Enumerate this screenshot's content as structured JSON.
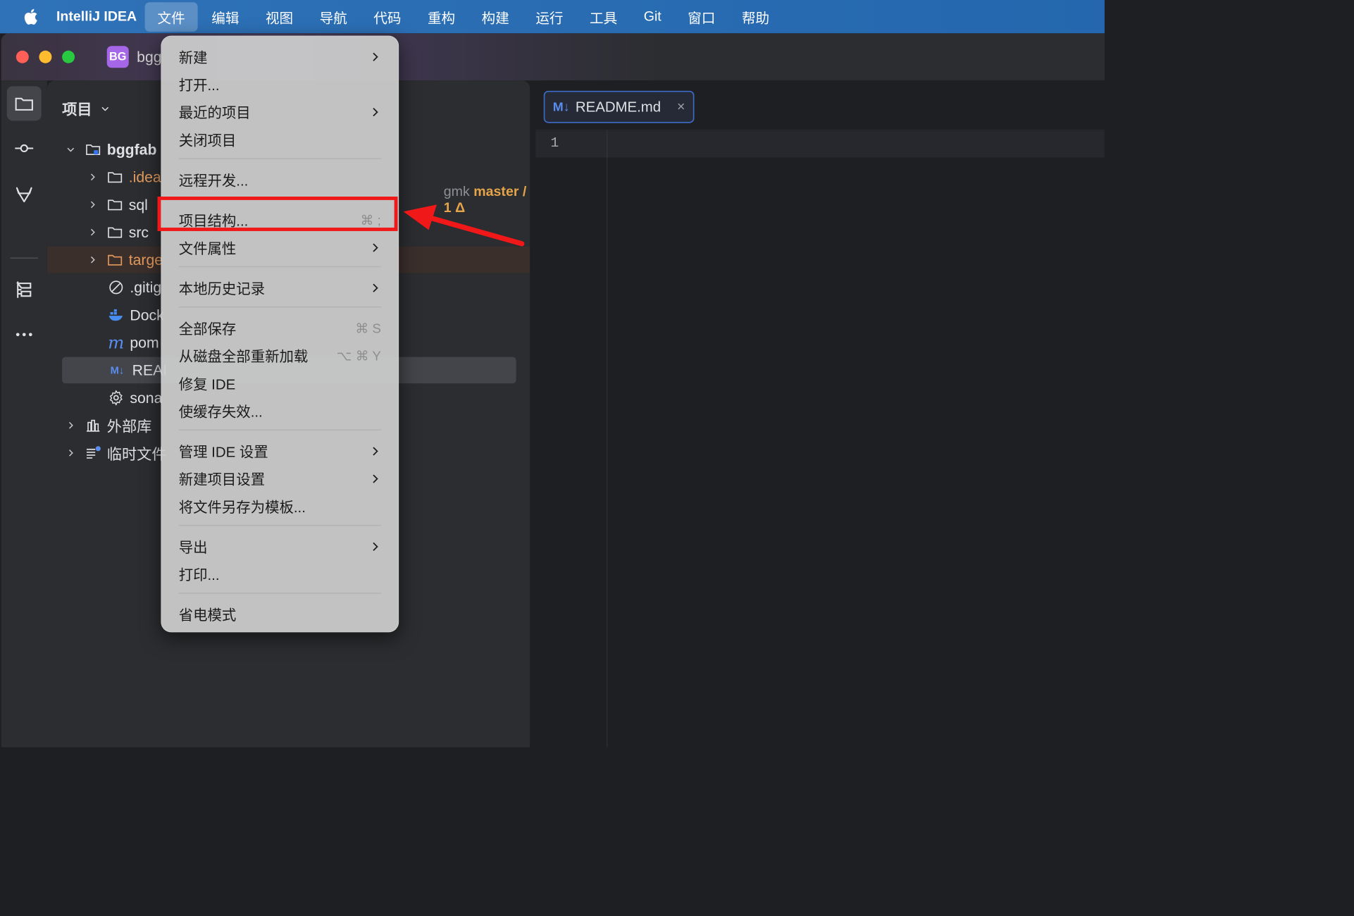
{
  "menubar": {
    "app_name": "IntelliJ IDEA",
    "items": [
      "文件",
      "编辑",
      "视图",
      "导航",
      "代码",
      "重构",
      "构建",
      "运行",
      "工具",
      "Git",
      "窗口",
      "帮助"
    ],
    "active_item": "文件"
  },
  "titlebar": {
    "project_badge": "BG",
    "project_name": "bgg"
  },
  "project_panel": {
    "title": "项目",
    "tree": [
      {
        "label": "bggfab",
        "type": "root-folder"
      },
      {
        "label": ".idea",
        "type": "folder"
      },
      {
        "label": "sql",
        "type": "folder"
      },
      {
        "label": "src",
        "type": "folder"
      },
      {
        "label": "targe",
        "type": "folder-excluded"
      },
      {
        "label": ".gitig",
        "type": "gitignore-file"
      },
      {
        "label": "Dock",
        "type": "docker-file"
      },
      {
        "label": "pom",
        "type": "maven-file"
      },
      {
        "label": "REAI",
        "type": "markdown-file"
      },
      {
        "label": "sona",
        "type": "settings-file"
      },
      {
        "label": "外部库",
        "type": "library"
      },
      {
        "label": "临时文件",
        "type": "scratches"
      }
    ],
    "vcs": {
      "user": "gmk",
      "branch": "master / 1 Δ"
    }
  },
  "editor": {
    "tab": {
      "badge": "M↓",
      "filename": "README.md",
      "close": "×"
    },
    "line_number": "1"
  },
  "file_menu": {
    "items": [
      {
        "label": "新建"
      },
      {
        "label": "打开..."
      },
      {
        "label": "最近的项目"
      },
      {
        "label": "关闭项目"
      },
      {
        "label": "远程开发..."
      },
      {
        "label": "项目结构...",
        "shortcut": "⌘ ;"
      },
      {
        "label": "文件属性"
      },
      {
        "label": "本地历史记录"
      },
      {
        "label": "全部保存",
        "shortcut": "⌘ S"
      },
      {
        "label": "从磁盘全部重新加载",
        "shortcut": "⌥ ⌘ Y"
      },
      {
        "label": "修复 IDE"
      },
      {
        "label": "使缓存失效..."
      },
      {
        "label": "管理 IDE 设置"
      },
      {
        "label": "新建项目设置"
      },
      {
        "label": "将文件另存为模板..."
      },
      {
        "label": "导出"
      },
      {
        "label": "打印..."
      },
      {
        "label": "省电模式"
      }
    ]
  },
  "colors": {
    "menubar_bg": "#2a6db3",
    "highlight_annotation": "#f01818",
    "branch": "#e5a44a",
    "excluded_folder": "#e49a5d",
    "markdown_badge": "#5a8dee"
  }
}
